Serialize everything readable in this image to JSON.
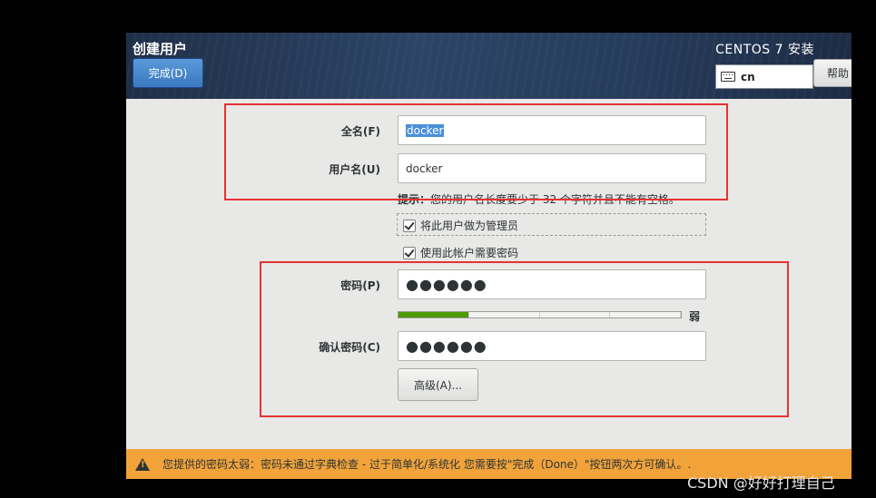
{
  "header": {
    "spoke_title": "创建用户",
    "done_label": "完成(D)",
    "product": "CENTOS 7 安装",
    "keyboard_layout": "cn",
    "help_label": "帮助"
  },
  "form": {
    "fullname_label": "全名(F)",
    "fullname_value": "docker",
    "username_label": "用户名(U)",
    "username_value": "docker",
    "hint_bold": "提示：",
    "hint_text": "您的用户名长度要少于 32 个字符并且不能有空格。",
    "admin_checkbox_label": "将此用户做为管理员",
    "admin_checked": true,
    "require_password_label": "使用此帐户需要密码",
    "require_password_checked": true,
    "password_label": "密码(P)",
    "password_value": "●●●●●●",
    "strength_fraction": 0.25,
    "strength_label": "弱",
    "confirm_label": "确认密码(C)",
    "confirm_value": "●●●●●●",
    "advanced_label": "高级(A)..."
  },
  "status": {
    "message": "您提供的密码太弱：密码未通过字典检查 - 过于简单化/系统化 您需要按\"完成（Done）\"按钮两次方可确认。."
  },
  "watermark": "CSDN @好好打理自己",
  "colors": {
    "header_bg": "#2c4466",
    "accent_button": "#3b78c0",
    "status_warning": "#f1a33a",
    "strength_weak": "#4e9a06",
    "annotation_red": "#e53333"
  }
}
